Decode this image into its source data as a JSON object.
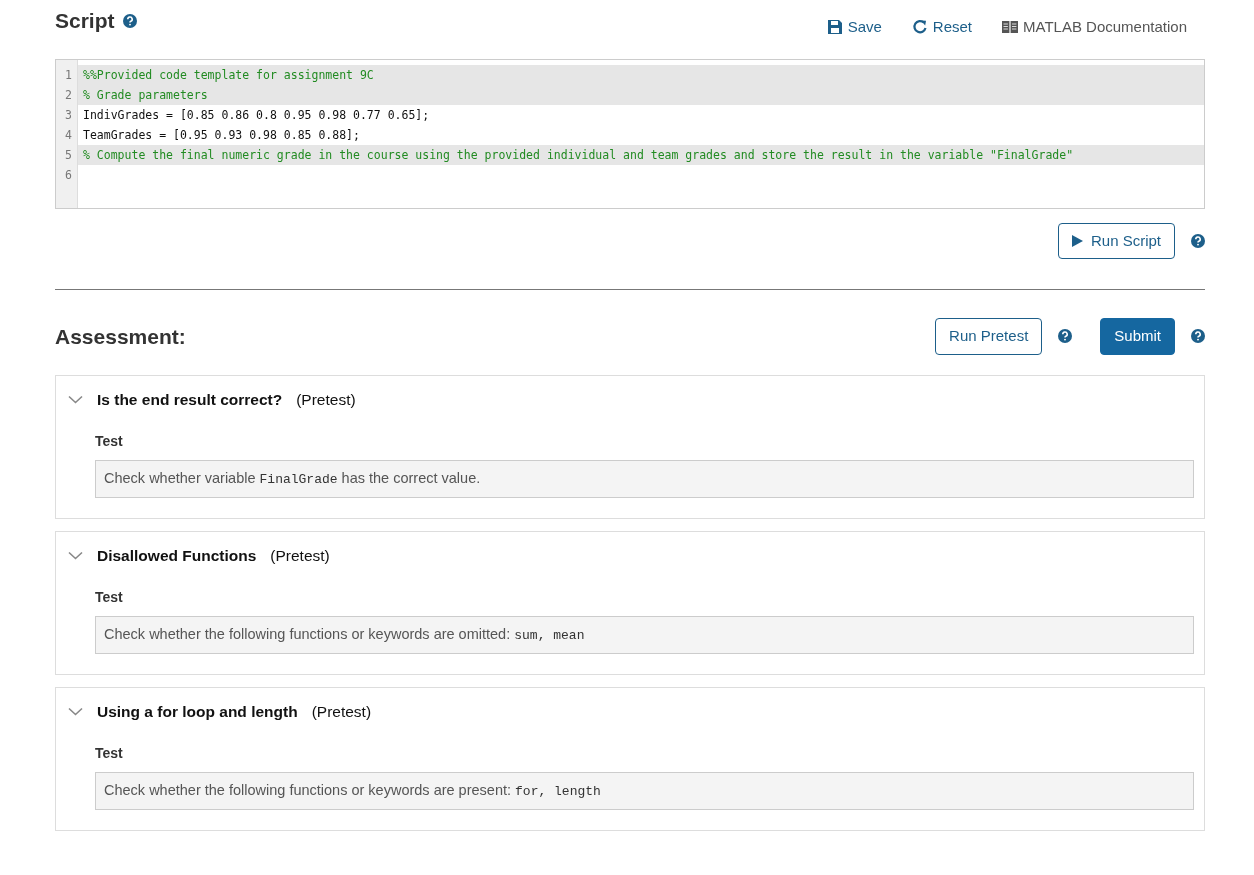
{
  "script": {
    "title": "Script",
    "toolbar": [
      {
        "label": "Save",
        "kind": "save"
      },
      {
        "label": "Reset",
        "kind": "reset"
      },
      {
        "label": "MATLAB Documentation",
        "kind": "docs"
      }
    ],
    "lines": [
      {
        "number": "1",
        "code": "%%Provided code template for assignment 9C",
        "kind": "comment",
        "locked": true
      },
      {
        "number": "2",
        "code": "% Grade parameters",
        "kind": "comment",
        "locked": true
      },
      {
        "number": "3",
        "code": "IndivGrades = [0.85 0.86 0.8 0.95 0.98 0.77 0.65];",
        "kind": "code",
        "locked": false
      },
      {
        "number": "4",
        "code": "TeamGrades = [0.95 0.93 0.98 0.85 0.88];",
        "kind": "code",
        "locked": false
      },
      {
        "number": "5",
        "code": "% Compute the final numeric grade in the course using the provided individual and team grades and store the result in the variable \"FinalGrade\"",
        "kind": "comment",
        "locked": true
      },
      {
        "number": "6",
        "locked": false
      }
    ],
    "run_button": "Run Script"
  },
  "assessment": {
    "title": "Assessment:",
    "pretest_button": "Run Pretest",
    "submit_button": "Submit",
    "tests": [
      {
        "title": "Is the end result correct?",
        "tag": "(Pretest)",
        "expanded": true,
        "label": "Test",
        "description": [
          {
            "kind": "text",
            "text": "Check whether variable "
          },
          {
            "kind": "code",
            "text": "FinalGrade"
          },
          {
            "kind": "text",
            "text": " has the correct value."
          }
        ]
      },
      {
        "title": "Disallowed Functions",
        "tag": "(Pretest)",
        "expanded": true,
        "label": "Test",
        "description": [
          {
            "kind": "text",
            "text": "Check whether the following functions or keywords are omitted: "
          },
          {
            "kind": "code",
            "text": "sum, mean"
          }
        ]
      },
      {
        "title": "Using a for loop and length",
        "tag": "(Pretest)",
        "expanded": true,
        "label": "Test",
        "description": [
          {
            "kind": "text",
            "text": "Check whether the following functions or keywords are present: "
          },
          {
            "kind": "code",
            "text": "for, length"
          }
        ]
      }
    ]
  }
}
